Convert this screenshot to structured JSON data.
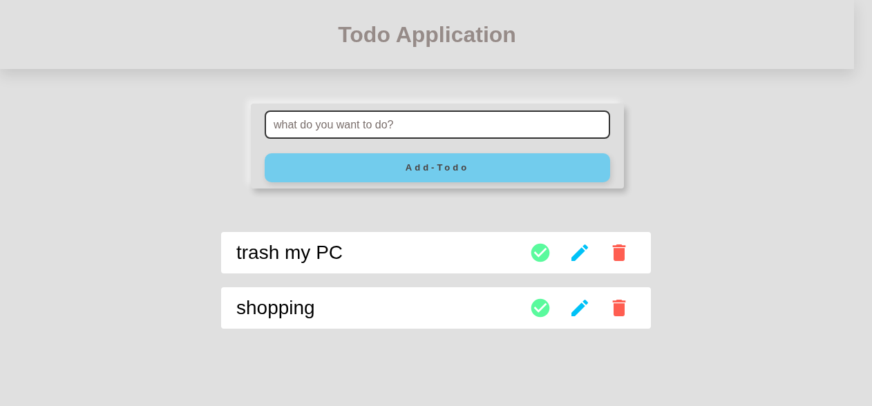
{
  "header": {
    "title": "Todo Application"
  },
  "form": {
    "placeholder": "what do you want to do?",
    "button": "Add-Todo"
  },
  "todos": [
    {
      "text": "trash my PC"
    },
    {
      "text": "shopping"
    }
  ]
}
